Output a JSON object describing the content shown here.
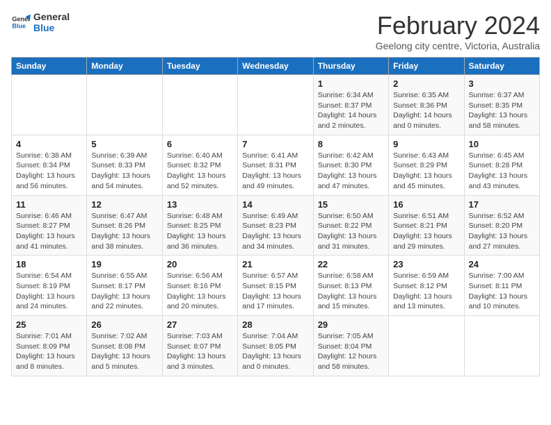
{
  "logo": {
    "line1": "General",
    "line2": "Blue"
  },
  "title": "February 2024",
  "subtitle": "Geelong city centre, Victoria, Australia",
  "days_header": [
    "Sunday",
    "Monday",
    "Tuesday",
    "Wednesday",
    "Thursday",
    "Friday",
    "Saturday"
  ],
  "weeks": [
    [
      {
        "day": "",
        "info": ""
      },
      {
        "day": "",
        "info": ""
      },
      {
        "day": "",
        "info": ""
      },
      {
        "day": "",
        "info": ""
      },
      {
        "day": "1",
        "info": "Sunrise: 6:34 AM\nSunset: 8:37 PM\nDaylight: 14 hours\nand 2 minutes."
      },
      {
        "day": "2",
        "info": "Sunrise: 6:35 AM\nSunset: 8:36 PM\nDaylight: 14 hours\nand 0 minutes."
      },
      {
        "day": "3",
        "info": "Sunrise: 6:37 AM\nSunset: 8:35 PM\nDaylight: 13 hours\nand 58 minutes."
      }
    ],
    [
      {
        "day": "4",
        "info": "Sunrise: 6:38 AM\nSunset: 8:34 PM\nDaylight: 13 hours\nand 56 minutes."
      },
      {
        "day": "5",
        "info": "Sunrise: 6:39 AM\nSunset: 8:33 PM\nDaylight: 13 hours\nand 54 minutes."
      },
      {
        "day": "6",
        "info": "Sunrise: 6:40 AM\nSunset: 8:32 PM\nDaylight: 13 hours\nand 52 minutes."
      },
      {
        "day": "7",
        "info": "Sunrise: 6:41 AM\nSunset: 8:31 PM\nDaylight: 13 hours\nand 49 minutes."
      },
      {
        "day": "8",
        "info": "Sunrise: 6:42 AM\nSunset: 8:30 PM\nDaylight: 13 hours\nand 47 minutes."
      },
      {
        "day": "9",
        "info": "Sunrise: 6:43 AM\nSunset: 8:29 PM\nDaylight: 13 hours\nand 45 minutes."
      },
      {
        "day": "10",
        "info": "Sunrise: 6:45 AM\nSunset: 8:28 PM\nDaylight: 13 hours\nand 43 minutes."
      }
    ],
    [
      {
        "day": "11",
        "info": "Sunrise: 6:46 AM\nSunset: 8:27 PM\nDaylight: 13 hours\nand 41 minutes."
      },
      {
        "day": "12",
        "info": "Sunrise: 6:47 AM\nSunset: 8:26 PM\nDaylight: 13 hours\nand 38 minutes."
      },
      {
        "day": "13",
        "info": "Sunrise: 6:48 AM\nSunset: 8:25 PM\nDaylight: 13 hours\nand 36 minutes."
      },
      {
        "day": "14",
        "info": "Sunrise: 6:49 AM\nSunset: 8:23 PM\nDaylight: 13 hours\nand 34 minutes."
      },
      {
        "day": "15",
        "info": "Sunrise: 6:50 AM\nSunset: 8:22 PM\nDaylight: 13 hours\nand 31 minutes."
      },
      {
        "day": "16",
        "info": "Sunrise: 6:51 AM\nSunset: 8:21 PM\nDaylight: 13 hours\nand 29 minutes."
      },
      {
        "day": "17",
        "info": "Sunrise: 6:52 AM\nSunset: 8:20 PM\nDaylight: 13 hours\nand 27 minutes."
      }
    ],
    [
      {
        "day": "18",
        "info": "Sunrise: 6:54 AM\nSunset: 8:19 PM\nDaylight: 13 hours\nand 24 minutes."
      },
      {
        "day": "19",
        "info": "Sunrise: 6:55 AM\nSunset: 8:17 PM\nDaylight: 13 hours\nand 22 minutes."
      },
      {
        "day": "20",
        "info": "Sunrise: 6:56 AM\nSunset: 8:16 PM\nDaylight: 13 hours\nand 20 minutes."
      },
      {
        "day": "21",
        "info": "Sunrise: 6:57 AM\nSunset: 8:15 PM\nDaylight: 13 hours\nand 17 minutes."
      },
      {
        "day": "22",
        "info": "Sunrise: 6:58 AM\nSunset: 8:13 PM\nDaylight: 13 hours\nand 15 minutes."
      },
      {
        "day": "23",
        "info": "Sunrise: 6:59 AM\nSunset: 8:12 PM\nDaylight: 13 hours\nand 13 minutes."
      },
      {
        "day": "24",
        "info": "Sunrise: 7:00 AM\nSunset: 8:11 PM\nDaylight: 13 hours\nand 10 minutes."
      }
    ],
    [
      {
        "day": "25",
        "info": "Sunrise: 7:01 AM\nSunset: 8:09 PM\nDaylight: 13 hours\nand 8 minutes."
      },
      {
        "day": "26",
        "info": "Sunrise: 7:02 AM\nSunset: 8:08 PM\nDaylight: 13 hours\nand 5 minutes."
      },
      {
        "day": "27",
        "info": "Sunrise: 7:03 AM\nSunset: 8:07 PM\nDaylight: 13 hours\nand 3 minutes."
      },
      {
        "day": "28",
        "info": "Sunrise: 7:04 AM\nSunset: 8:05 PM\nDaylight: 13 hours\nand 0 minutes."
      },
      {
        "day": "29",
        "info": "Sunrise: 7:05 AM\nSunset: 8:04 PM\nDaylight: 12 hours\nand 58 minutes."
      },
      {
        "day": "",
        "info": ""
      },
      {
        "day": "",
        "info": ""
      }
    ]
  ]
}
